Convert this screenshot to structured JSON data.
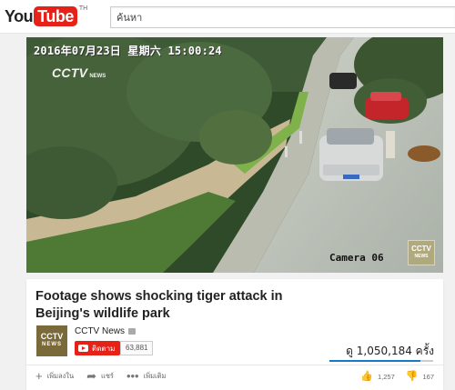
{
  "masthead": {
    "logo_you": "You",
    "logo_tube": "Tube",
    "logo_suffix": "TH",
    "search_placeholder": "ค้นหา"
  },
  "video_frame": {
    "timestamp": "2016年07月23日 星期六 15:00:24",
    "broadcaster_logo": "CCTV",
    "broadcaster_sub": "NEWS",
    "camera_label": "Camera 06",
    "watermark": "CCTV",
    "watermark_sub": "NEWS"
  },
  "video": {
    "title": "Footage shows shocking tiger attack in Beijing's wildlife park",
    "views": "ดู 1,050,184 ครั้ง",
    "like_ratio": 0.88
  },
  "channel": {
    "name": "CCTV News",
    "avatar_text": "CCTV",
    "avatar_sub": "NEWS",
    "subscribe_label": "ติดตาม",
    "subscriber_count": "63,881"
  },
  "actions": {
    "add_to_label": "เพิ่มลงใน",
    "share_label": "แชร์",
    "more_label": "เพิ่มเติม"
  },
  "ratings": {
    "likes": "1,257",
    "dislikes": "167"
  },
  "icons": {
    "add": "plus-icon",
    "share": "share-arrow-icon",
    "more": "more-dots-icon",
    "like": "thumbs-up-icon",
    "dislike": "thumbs-down-icon"
  },
  "colors": {
    "brand_red": "#e62117",
    "like_blue": "#167ac6"
  }
}
